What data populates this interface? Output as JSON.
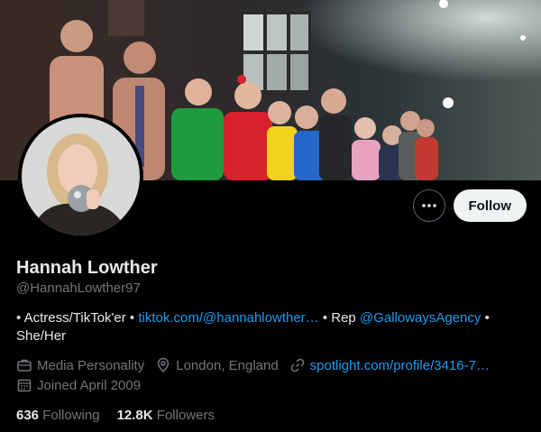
{
  "profile": {
    "name": "Hannah Lowther",
    "handle": "@HannahLowther97"
  },
  "actions": {
    "more_icon": "ellipsis-icon",
    "follow_label": "Follow"
  },
  "bio": {
    "part1": "• Actress/TikTok'er • ",
    "link1": "tiktok.com/@hannahlowther…",
    "part2": " • Rep ",
    "mention": "@GallowaysAgency",
    "part3": " • She/Her"
  },
  "meta": {
    "category": "Media Personality",
    "location": "London, England",
    "website": "spotlight.com/profile/3416-7…",
    "joined": "Joined April 2009"
  },
  "stats": {
    "following_count": "636",
    "following_label": "Following",
    "followers_count": "12.8K",
    "followers_label": "Followers"
  },
  "colors": {
    "background": "#000000",
    "link": "#1d9bf0",
    "muted": "#71767b",
    "text": "#e7e9ea",
    "follow_bg": "#eff3f4"
  }
}
